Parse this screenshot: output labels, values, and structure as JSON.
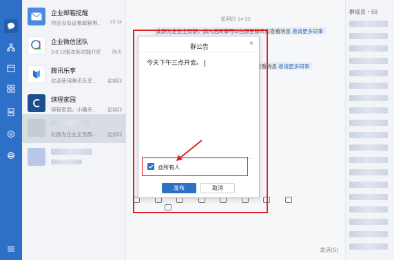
{
  "conversations": [
    {
      "title": "企业邮箱提醒",
      "preview": "你还没有设置邮箱地...",
      "time": "15:14"
    },
    {
      "title": "企业微信团队",
      "preview": "3.0.12版本新功能介绍",
      "time": "昨天"
    },
    {
      "title": "腾讯乐享",
      "preview": "欢迎使用腾讯乐享...",
      "time": "星期四"
    },
    {
      "title": "缤程家园",
      "preview": "缤程家园，小确幸...",
      "time": "星期四"
    },
    {
      "title": "",
      "preview": "此群为企业全员群...",
      "time": "星期四"
    }
  ],
  "chat": {
    "timestamp": "星期四 14:33",
    "system_msg_1_text": "此群为企业全员群，加入后同事可以在群里聊天和查看消息",
    "system_msg_1_link": "邀请更多同事",
    "system_msg_2_text": "员工可以通过群聊天和查看消息",
    "system_msg_2_link": "邀请更多同事",
    "send_hint": "发送(S)"
  },
  "members": {
    "label": "群成员・59"
  },
  "dialog": {
    "title": "群公告",
    "close": "×",
    "content": "今天下午三点开会。",
    "mention_all_label": "@所有人",
    "publish_button": "发布",
    "cancel_button": "取消"
  },
  "colors": {
    "accent": "#2e6fc7",
    "highlight": "#e02020"
  }
}
